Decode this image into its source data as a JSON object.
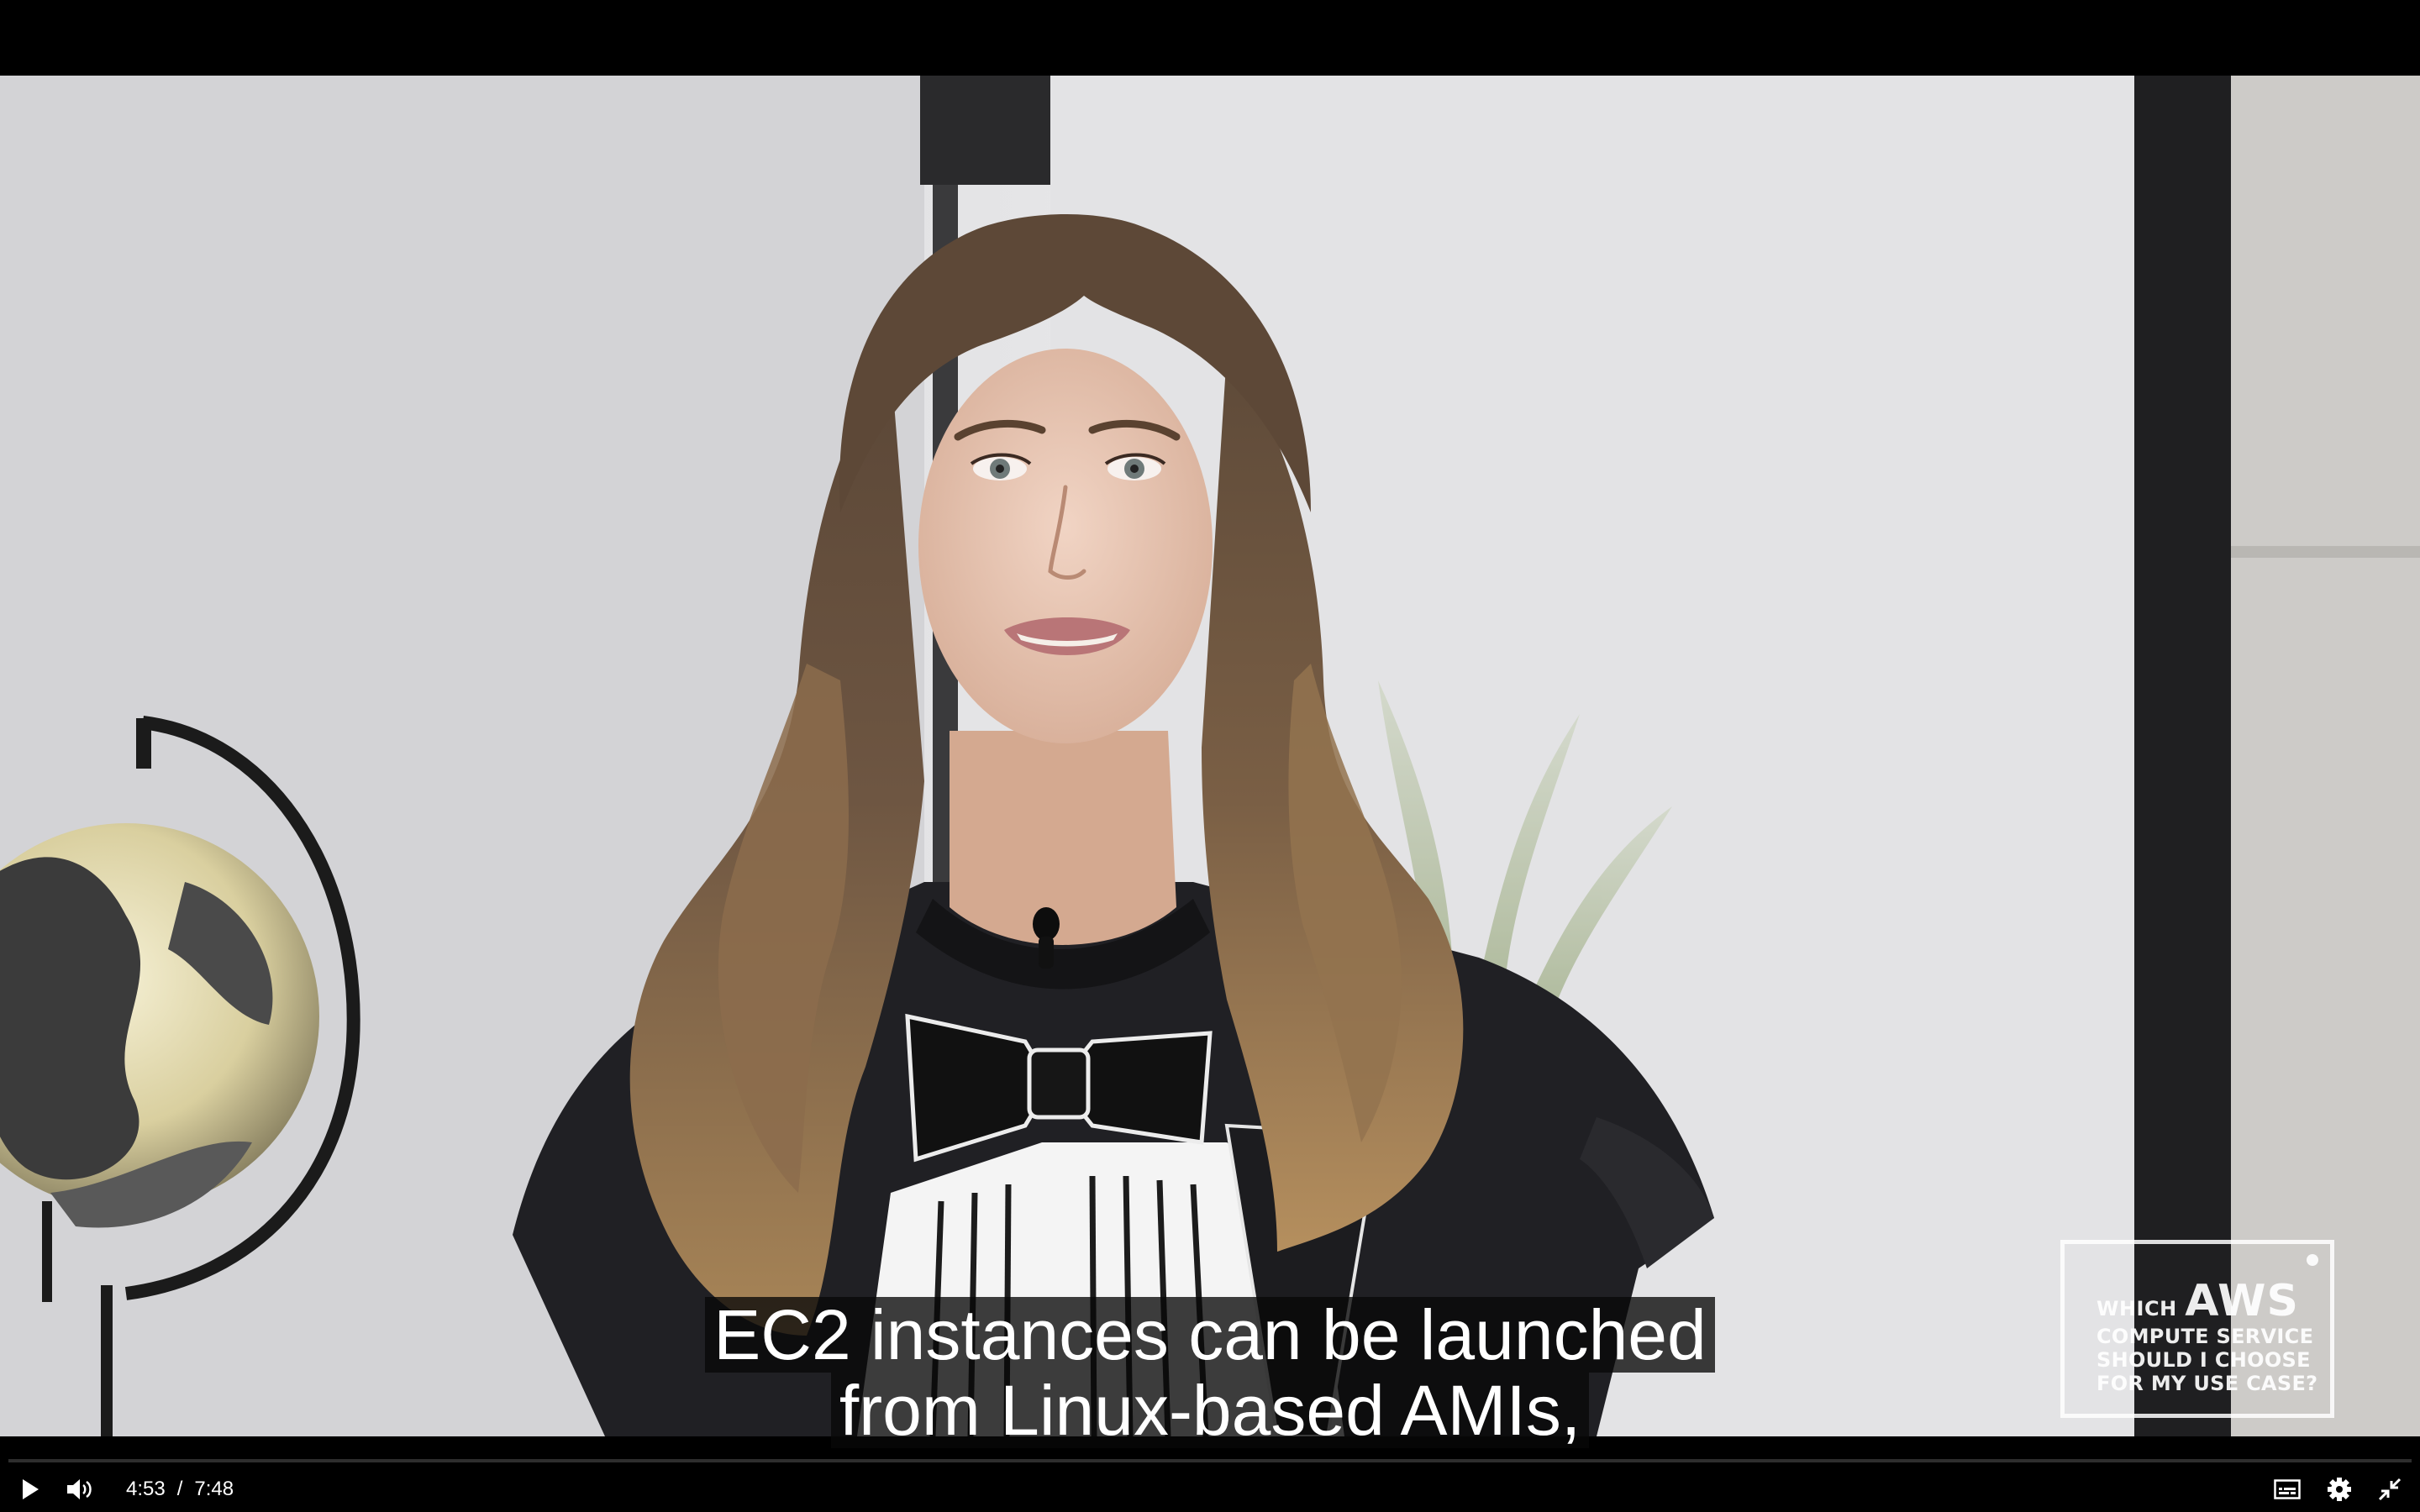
{
  "video": {
    "captions": [
      "EC2 instances can be launched",
      "from Linux-based AMIs,"
    ],
    "watermark": {
      "word1": "WHICH",
      "brand": "AWS",
      "line2": "COMPUTE SERVICE",
      "line3": "SHOULD I CHOOSE",
      "line4": "FOR MY USE CASE?"
    }
  },
  "controls": {
    "current_time": "4:53",
    "separator": "/",
    "duration": "7:48",
    "progress_fraction": 0.0,
    "progress_color": "#1ec88c",
    "icons": [
      "play-icon",
      "volume-icon",
      "captions-icon",
      "settings-icon",
      "exit-fullscreen-icon"
    ]
  }
}
